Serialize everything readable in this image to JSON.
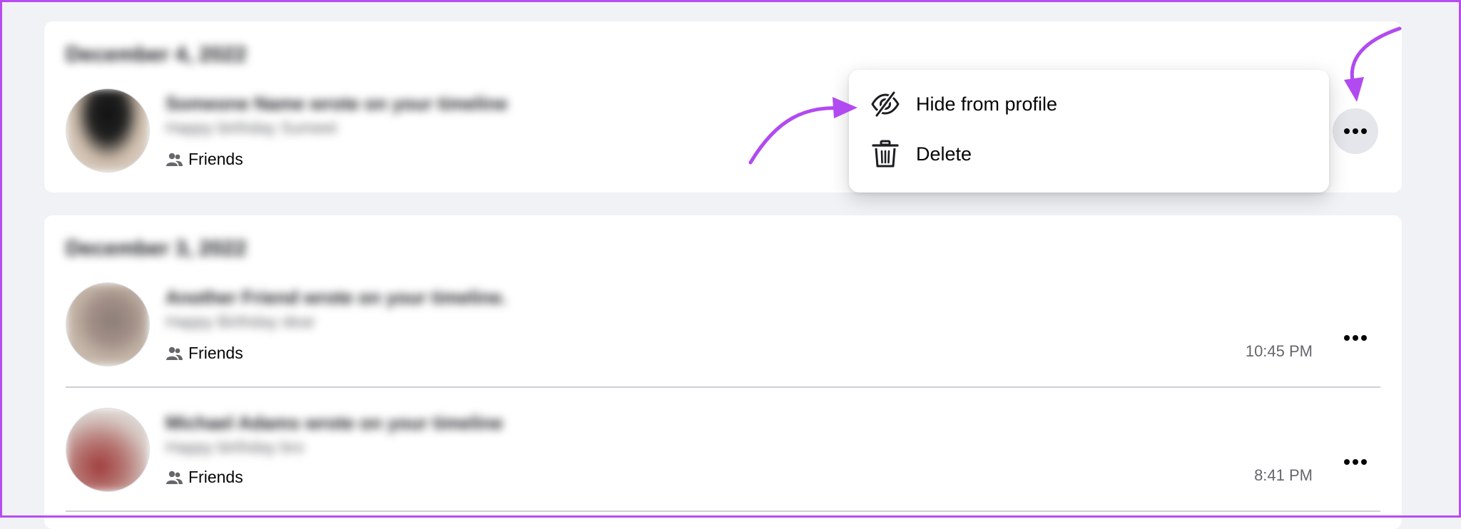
{
  "colors": {
    "accent_arrow": "#b14af0",
    "page_bg": "#f0f2f5",
    "card_bg": "#ffffff",
    "muted_text": "#65676b"
  },
  "sections": [
    {
      "date": "December 4, 2022",
      "entries": [
        {
          "title": "Someone Name wrote on your timeline",
          "subtitle": "Happy birthday Sumeet",
          "audience": "Friends",
          "audience_icon": "friends-icon",
          "time": ""
        }
      ]
    },
    {
      "date": "December 3, 2022",
      "entries": [
        {
          "title": "Another Friend wrote on your timeline.",
          "subtitle": "Happy Birthday dear",
          "audience": "Friends",
          "audience_icon": "friends-icon",
          "time": "10:45 PM"
        },
        {
          "title": "Michael Adams wrote on your timeline",
          "subtitle": "Happy birthday bro",
          "audience": "Friends",
          "audience_icon": "friends-icon",
          "time": "8:41 PM"
        }
      ]
    }
  ],
  "context_menu": {
    "items": [
      {
        "label": "Hide from profile",
        "icon": "eye-slash-icon"
      },
      {
        "label": "Delete",
        "icon": "trash-icon"
      }
    ]
  }
}
